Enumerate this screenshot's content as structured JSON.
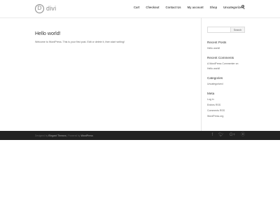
{
  "header": {
    "logo_mark": "D",
    "logo_text": "divi",
    "nav": [
      "Cart",
      "Checkout",
      "Contact Us",
      "My account",
      "Shop",
      "Uncategorized"
    ]
  },
  "post": {
    "title": "Hello world!",
    "text": "Welcome to WordPress. This is your first post. Edit or delete it, then start writing!"
  },
  "sidebar": {
    "search_button": "Search",
    "recent_posts_title": "Recent Posts",
    "recent_posts": [
      "Hello world!"
    ],
    "recent_comments_title": "Recent Comments",
    "recent_comments_line1": "A WordPress Commenter on",
    "recent_comments_line2": "Hello world!",
    "categories_title": "Categories",
    "categories": [
      "Uncategorized"
    ],
    "meta_title": "Meta",
    "meta": [
      "Log in",
      "Entries RSS",
      "Comments RSS",
      "WordPress.org"
    ]
  },
  "footer": {
    "designed_by": "Designed by",
    "theme_name": "Elegant Themes",
    "separator": " | Powered by ",
    "powered_by": "WordPress",
    "social": [
      "facebook-icon",
      "twitter-icon",
      "google-plus-icon",
      "rss-icon"
    ]
  },
  "colors": {
    "footer_bg": "#222222",
    "text": "#666666",
    "heading": "#333333"
  }
}
